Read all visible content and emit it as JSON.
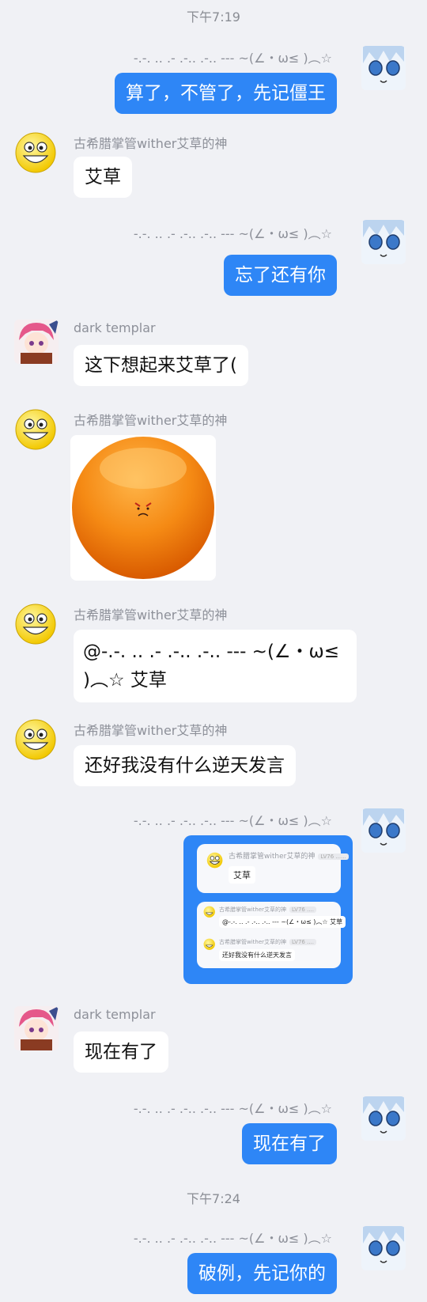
{
  "timestamps": [
    "下午7:19",
    "下午7:24"
  ],
  "self_name": "-.-. .. .- .-.. .-.. --- ~(∠・ω≤ )︵☆",
  "users": {
    "u1": "古希腊掌管wither艾草的神",
    "u2": "dark templar"
  },
  "messages": [
    {
      "text": "算了，不管了，先记僵王"
    },
    {
      "text": "艾草"
    },
    {
      "text": "忘了还有你"
    },
    {
      "text": "这下想起来艾草了("
    },
    {
      "text": "@-.-. .. .- .-.. .-.. --- ~(∠・ω≤ )︵☆ 艾草"
    },
    {
      "text": "还好我没有什么逆天发言"
    },
    {
      "text": "现在有了"
    },
    {
      "text": "现在有了"
    },
    {
      "text": "破例，先记你的"
    }
  ],
  "forward": {
    "card1": {
      "name": "古希腊掌管wither艾草的神",
      "tag": "LV76 ......",
      "text": "艾草"
    },
    "card2": [
      {
        "name": "古希腊掌管wither艾草的神",
        "tag": "LV76 ....",
        "text": "@-.-. .. .- .-.. .-.. --- ~(∠・ω≤ )︵☆ 艾草"
      },
      {
        "name": "古希腊掌管wither艾草的神",
        "tag": "LV76 ....",
        "text": "还好我没有什么逆天发言"
      }
    ]
  },
  "colors": {
    "accent": "#2e86f6",
    "background": "#f0f1f5",
    "orange_sticker": "#f07a10"
  },
  "icons": {
    "self_avatar": "anime-girl-blue-hair",
    "u1_avatar": "grinning-face-emoji",
    "u2_avatar": "anime-girl-pink-hair",
    "sticker": "angry-orange-ball"
  }
}
